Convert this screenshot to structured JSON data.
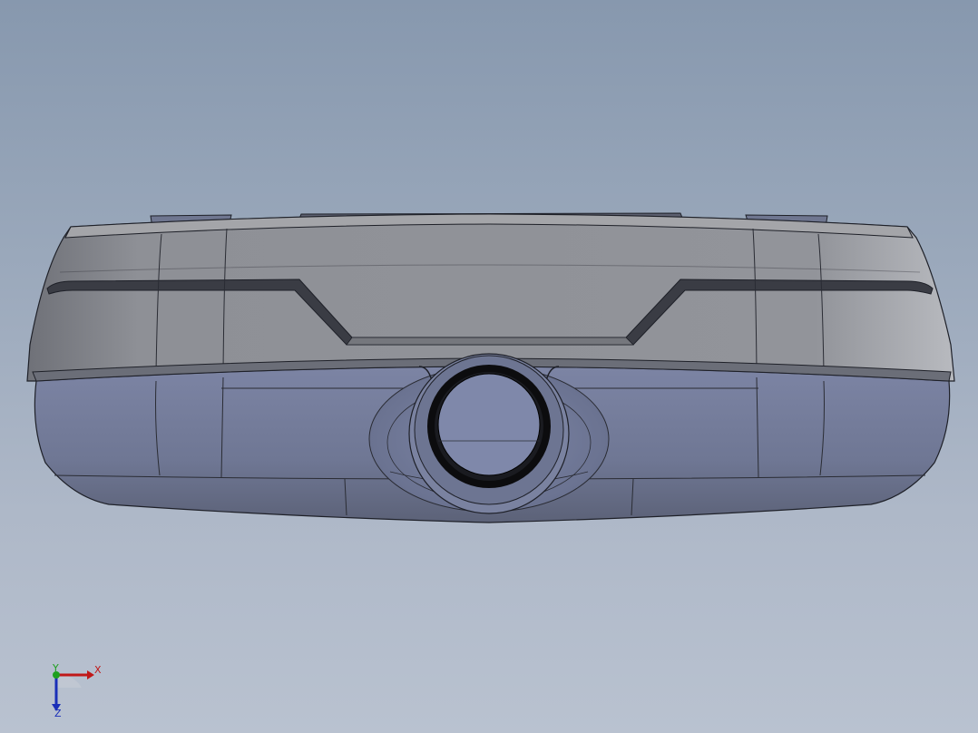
{
  "viewport": {
    "background_top": "#8798ae",
    "background_bottom": "#b9c2d0"
  },
  "model": {
    "name": "",
    "body_color": "#8c8e93",
    "lower_color": "#717895",
    "edge_color": "#1e2028",
    "ring_color": "#0c0c0e"
  },
  "triad": {
    "x_label": "X",
    "y_label": "Y",
    "z_label": "Z",
    "x_color": "#c01818",
    "y_color": "#1ea01e",
    "z_color": "#1a2fb8"
  }
}
